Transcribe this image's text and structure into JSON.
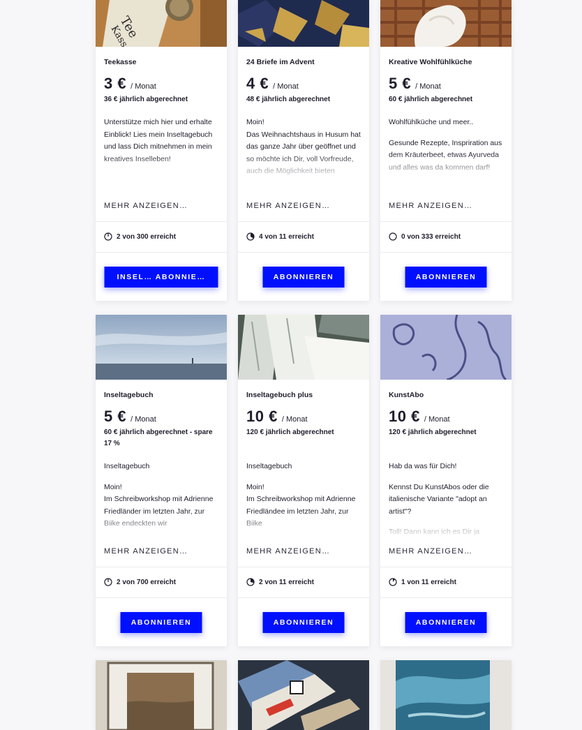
{
  "tiers": [
    {
      "title": "Teekasse",
      "amount": "3 €",
      "period": "/ Monat",
      "billed": "36 € jährlich abgerechnet",
      "paragraphs": [
        "Unterstütze mich hier und erhalte Einblick! Lies mein Inseltagebuch und lass Dich mitnehmen in mein kreatives Inselleben!"
      ],
      "more": "MEHR ANZEIGEN…",
      "progress": "2 von 300 erreicht",
      "progress_fraction": 0.0067,
      "button": "INSEL… ABONNIE…",
      "image": "tea-box-photo"
    },
    {
      "title": "24 Briefe im Advent",
      "amount": "4 €",
      "period": "/ Monat",
      "billed": "48 € jährlich abgerechnet",
      "paragraphs": [
        "Moin!\nDas Weihnachtshaus in Husum hat das ganze Jahr über geöffnet und so möchte ich Dir, voll Vorfreude, auch die Möglichkeit bieten meinen"
      ],
      "more": "MEHR ANZEIGEN…",
      "progress": "4 von 11 erreicht",
      "progress_fraction": 0.364,
      "button": "ABONNIEREN",
      "image": "gold-leaf-photo"
    },
    {
      "title": "Kreative Wohlfühlküche",
      "amount": "5 €",
      "period": "/ Monat",
      "billed": "60 € jährlich abgerechnet",
      "paragraphs": [
        "Wohlfühlküche und meer..",
        "Gesunde Rezepte, Inspriration aus dem Kräuterbeet, etwas Ayurveda und alles was da kommen darf!"
      ],
      "more": "MEHR ANZEIGEN…",
      "progress": "0 von 333 erreicht",
      "progress_fraction": 0,
      "button": "ABONNIEREN",
      "image": "waffle-cream-photo"
    },
    {
      "title": "Inseltagebuch",
      "amount": "5 €",
      "period": "/ Monat",
      "billed": "60 € jährlich abgerechnet - spare 17 %",
      "paragraphs": [
        "Inseltagebuch",
        "Moin!\nIm Schreibworkshop mit Adrienne Friedländer im letzten Jahr, zur Biike endeckten wir"
      ],
      "more": "MEHR ANZEIGEN…",
      "progress": "2 von 700 erreicht",
      "progress_fraction": 0.003,
      "button": "ABONNIEREN",
      "image": "sea-horizon-photo"
    },
    {
      "title": "Inseltagebuch plus",
      "amount": "10 €",
      "period": "/ Monat",
      "billed": "120 € jährlich abgerechnet",
      "paragraphs": [
        "Inseltagebuch",
        "Moin!\nIm Schreibworkshop mit Adrienne Friedländee im letzten Jahr, zur Biike"
      ],
      "more": "MEHR ANZEIGEN…",
      "progress": "2 von 11 erreicht",
      "progress_fraction": 0.182,
      "button": "ABONNIEREN",
      "image": "paper-stack-photo"
    },
    {
      "title": "KunstAbo",
      "amount": "10 €",
      "period": "/ Monat",
      "billed": "120 € jährlich abgerechnet",
      "paragraphs": [
        "Hab da was für Dich!",
        "Kennst Du KunstAbos oder die italienische Variante \"adopt an artist\"?",
        "Toll! Dann kann ich es Dir ja"
      ],
      "more": "MEHR ANZEIGEN…",
      "progress": "1 von 11 erreicht",
      "progress_fraction": 0.091,
      "button": "ABONNIEREN",
      "image": "blue-print-photo"
    }
  ],
  "bottom_row_images": [
    "framed-print-photo",
    "postcards-photo",
    "blue-painting-photo"
  ],
  "colors": {
    "accent": "#0010ff",
    "text": "#1f1d2b",
    "background": "#f7f7f9"
  }
}
